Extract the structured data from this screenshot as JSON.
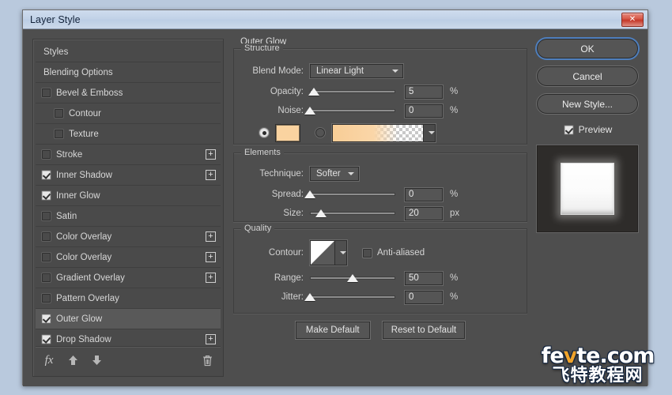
{
  "window": {
    "title": "Layer Style",
    "close_label": "✕"
  },
  "styles_panel": {
    "rows": [
      {
        "label": "Styles",
        "type": "header",
        "checked": null,
        "indent": false,
        "plus": false,
        "selected": false
      },
      {
        "label": "Blending Options",
        "type": "header",
        "checked": null,
        "indent": false,
        "plus": false,
        "selected": false
      },
      {
        "label": "Bevel & Emboss",
        "type": "effect",
        "checked": false,
        "indent": false,
        "plus": false,
        "selected": false
      },
      {
        "label": "Contour",
        "type": "sub",
        "checked": false,
        "indent": true,
        "plus": false,
        "selected": false
      },
      {
        "label": "Texture",
        "type": "sub",
        "checked": false,
        "indent": true,
        "plus": false,
        "selected": false
      },
      {
        "label": "Stroke",
        "type": "effect",
        "checked": false,
        "indent": false,
        "plus": true,
        "selected": false
      },
      {
        "label": "Inner Shadow",
        "type": "effect",
        "checked": true,
        "indent": false,
        "plus": true,
        "selected": false
      },
      {
        "label": "Inner Glow",
        "type": "effect",
        "checked": true,
        "indent": false,
        "plus": false,
        "selected": false
      },
      {
        "label": "Satin",
        "type": "effect",
        "checked": false,
        "indent": false,
        "plus": false,
        "selected": false
      },
      {
        "label": "Color Overlay",
        "type": "effect",
        "checked": false,
        "indent": false,
        "plus": true,
        "selected": false
      },
      {
        "label": "Color Overlay",
        "type": "effect",
        "checked": false,
        "indent": false,
        "plus": true,
        "selected": false
      },
      {
        "label": "Gradient Overlay",
        "type": "effect",
        "checked": false,
        "indent": false,
        "plus": true,
        "selected": false
      },
      {
        "label": "Pattern Overlay",
        "type": "effect",
        "checked": false,
        "indent": false,
        "plus": false,
        "selected": false
      },
      {
        "label": "Outer Glow",
        "type": "effect",
        "checked": true,
        "indent": false,
        "plus": false,
        "selected": true
      },
      {
        "label": "Drop Shadow",
        "type": "effect",
        "checked": true,
        "indent": false,
        "plus": true,
        "selected": false
      }
    ],
    "toolbar": {
      "fx": "fx",
      "up": "▲",
      "down": "▼",
      "trash": "trash"
    }
  },
  "effect": {
    "name": "Outer Glow",
    "structure": {
      "title": "Structure",
      "blend_mode_label": "Blend Mode:",
      "blend_mode_value": "Linear Light",
      "opacity_label": "Opacity:",
      "opacity_value": "5",
      "opacity_unit": "%",
      "opacity_pct": 5,
      "noise_label": "Noise:",
      "noise_value": "0",
      "noise_unit": "%",
      "noise_pct": 0,
      "fill_type": "color",
      "color_hex": "#fad3a0",
      "gradient_from": "#f8cd96",
      "gradient_to": "transparent"
    },
    "elements": {
      "title": "Elements",
      "technique_label": "Technique:",
      "technique_value": "Softer",
      "spread_label": "Spread:",
      "spread_value": "0",
      "spread_unit": "%",
      "spread_pct": 0,
      "size_label": "Size:",
      "size_value": "20",
      "size_unit": "px",
      "size_pct": 13
    },
    "quality": {
      "title": "Quality",
      "contour_label": "Contour:",
      "anti_aliased_label": "Anti-aliased",
      "anti_aliased_checked": false,
      "range_label": "Range:",
      "range_value": "50",
      "range_unit": "%",
      "range_pct": 50,
      "jitter_label": "Jitter:",
      "jitter_value": "0",
      "jitter_unit": "%",
      "jitter_pct": 0
    }
  },
  "defaults": {
    "make_default": "Make Default",
    "reset_to_default": "Reset to Default"
  },
  "actions": {
    "ok": "OK",
    "cancel": "Cancel",
    "new_style": "New Style...",
    "preview_label": "Preview",
    "preview_checked": true
  },
  "watermark": {
    "line1_a": "fe",
    "line1_b": "v",
    "line1_c": "te.com",
    "line2": "飞特教程网"
  }
}
